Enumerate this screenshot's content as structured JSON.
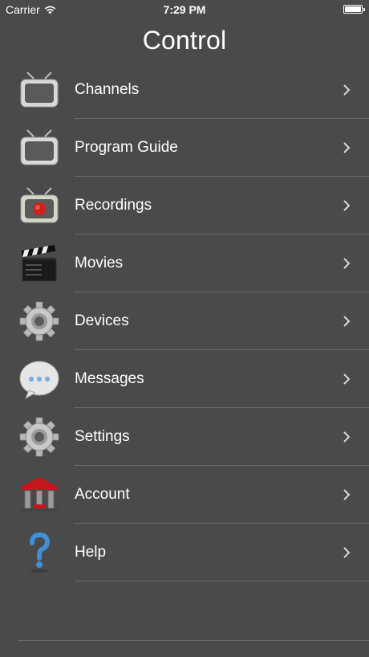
{
  "status_bar": {
    "carrier": "Carrier",
    "time": "7:29 PM"
  },
  "nav": {
    "title": "Control"
  },
  "menu": {
    "items": [
      {
        "label": "Channels",
        "icon": "tv-icon"
      },
      {
        "label": "Program Guide",
        "icon": "tv-guide-icon"
      },
      {
        "label": "Recordings",
        "icon": "tv-record-icon"
      },
      {
        "label": "Movies",
        "icon": "clapperboard-icon"
      },
      {
        "label": "Devices",
        "icon": "gear-icon"
      },
      {
        "label": "Messages",
        "icon": "chat-bubble-icon"
      },
      {
        "label": "Settings",
        "icon": "gear-icon"
      },
      {
        "label": "Account",
        "icon": "bank-icon"
      },
      {
        "label": "Help",
        "icon": "question-mark-icon"
      }
    ]
  },
  "colors": {
    "background": "#4a4a4a",
    "divider": "#6a6a6a",
    "text": "#ffffff",
    "record_red": "#d0201a"
  }
}
